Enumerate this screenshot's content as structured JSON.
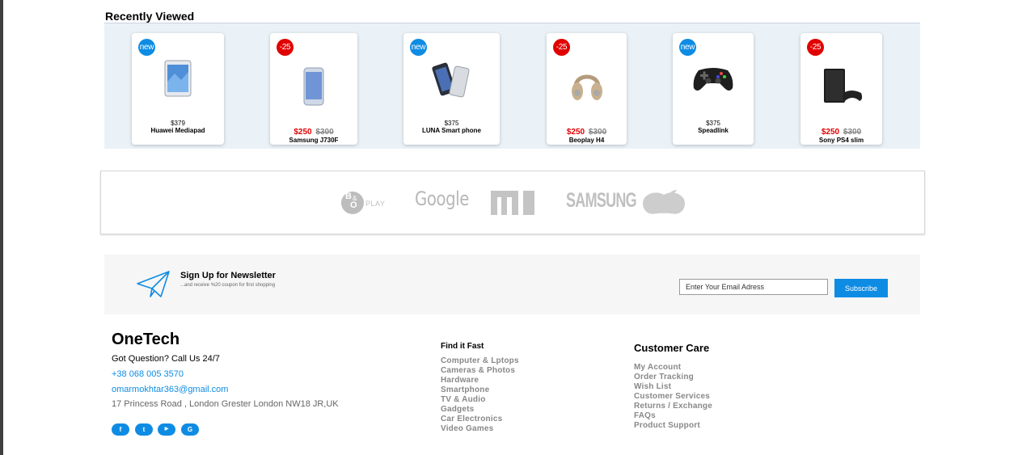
{
  "recently_viewed": {
    "title": "Recently Viewed",
    "items": [
      {
        "badge": "new",
        "badge_type": "new",
        "price": "$379",
        "name": "Huawei Mediapad",
        "thumb": "tablet"
      },
      {
        "badge": "-25",
        "badge_type": "sale",
        "price": "$250",
        "old_price": "$300",
        "name": "Samsung J730F",
        "thumb": "phone-blue"
      },
      {
        "badge": "new",
        "badge_type": "new",
        "price": "$375",
        "name": "LUNA Smart phone",
        "thumb": "phone-pair"
      },
      {
        "badge": "-25",
        "badge_type": "sale",
        "price": "$250",
        "old_price": "$300",
        "name": "Beoplay H4",
        "thumb": "headphones"
      },
      {
        "badge": "new",
        "badge_type": "new",
        "price": "$375",
        "name": "Speadlink",
        "thumb": "gamepad"
      },
      {
        "badge": "-25",
        "badge_type": "sale",
        "price": "$250",
        "old_price": "$300",
        "name": "Sony PS4 slim",
        "thumb": "console"
      }
    ]
  },
  "brands": {
    "bo_top": "B",
    "bo_bottom": "O",
    "bo_amp": "&",
    "bo_play": "PLAY",
    "google": "Google",
    "samsung": "SAMSUNG"
  },
  "newsletter": {
    "title": "Sign Up for Newsletter",
    "subtitle": "...and receive %20 coupon for first shopping",
    "placeholder": "Enter Your Email Adress",
    "button": "Subscribe"
  },
  "footer": {
    "brand": "OneTech",
    "question": "Got Question? Call Us 24/7",
    "phone": "+38 068 005 3570",
    "email": "omarmokhtar363@gmail.com",
    "address": "17 Princess Road , London Grester London NW18 JR,UK",
    "socials": [
      {
        "icon": "facebook-icon",
        "glyph": "f"
      },
      {
        "icon": "twitter-icon",
        "glyph": "t"
      },
      {
        "icon": "youtube-icon",
        "glyph": "▶"
      },
      {
        "icon": "google-icon",
        "glyph": "G"
      }
    ],
    "find_it_fast": {
      "title": "Find it Fast",
      "links": [
        "Computer & Lptops",
        "Cameras & Photos",
        "Hardware",
        "Smartphone",
        "TV & Audio",
        "Gadgets",
        "Car Electronics",
        "Video Games"
      ]
    },
    "customer_care": {
      "title": "Customer Care",
      "links": [
        "My Account",
        "Order Tracking",
        "Wish List",
        "Customer Services",
        "Returns / Exchange",
        "FAQs",
        "Product Support"
      ]
    }
  },
  "colors": {
    "accent": "#0e8ce4",
    "sale": "#e00000",
    "band": "#eaf2f8",
    "logo_gray": "#b8b8b8"
  }
}
